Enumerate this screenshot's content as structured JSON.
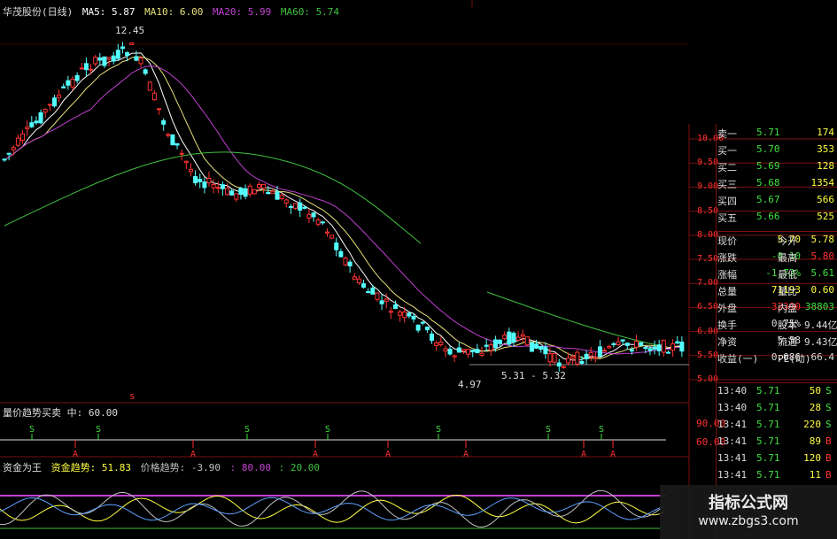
{
  "header": {
    "title": "华茂股份(日线)",
    "ma5": "MA5: 5.87",
    "ma10": "MA10: 6.00",
    "ma20": "MA20: 5.99",
    "ma60": "MA60: 5.74"
  },
  "annotations": {
    "high": "12.45",
    "low": "4.97",
    "range": "5.31 - 5.32",
    "marker": "s"
  },
  "price_axis": [
    "10.00",
    "9.50",
    "9.00",
    "8.50",
    "8.00",
    "7.50",
    "7.00",
    "6.50",
    "6.00",
    "5.50",
    "5.00"
  ],
  "vol_indicator": {
    "label": "量价趋势买卖 中: 60.00",
    "axis": [
      "90.00",
      "60.00"
    ]
  },
  "money_indicator": {
    "title": "资金为王",
    "fund": "资金趋势: 51.83",
    "price": "价格趋势: -3.90",
    "v80": ": 80.00",
    "v20": ": 20.00"
  },
  "order_book": [
    {
      "label": "卖一",
      "price": "5.71",
      "vol": "174"
    },
    {
      "label": "买一",
      "price": "5.70",
      "vol": "353"
    },
    {
      "label": "买二",
      "price": "5.69",
      "vol": "128"
    },
    {
      "label": "买三",
      "price": "5.68",
      "vol": "1354"
    },
    {
      "label": "买四",
      "price": "5.67",
      "vol": "566"
    },
    {
      "label": "买五",
      "price": "5.66",
      "vol": "525"
    }
  ],
  "quote": [
    {
      "l1": "现价",
      "v1": "5.70",
      "l2": "今开",
      "v2": "5.78"
    },
    {
      "l1": "涨跌",
      "v1": "-0.10",
      "l2": "最高",
      "v2": "5.80"
    },
    {
      "l1": "涨幅",
      "v1": "-1.72%",
      "l2": "最低",
      "v2": "5.61"
    },
    {
      "l1": "总量",
      "v1": "71193",
      "l2": "量比",
      "v2": "0.60"
    },
    {
      "l1": "外盘",
      "v1": "32390",
      "l2": "内盘",
      "v2": "38803"
    },
    {
      "l1": "换手",
      "v1": "0.75%",
      "l2": "股本",
      "v2": "9.44亿"
    },
    {
      "l1": "净资",
      "v1": "5.58",
      "l2": "流通",
      "v2": "9.43亿"
    },
    {
      "l1": "收益(一)",
      "v1": "0.086",
      "l2": "PE(动)",
      "v2": "66.4"
    }
  ],
  "ticks": [
    {
      "time": "13:40",
      "price": "5.71",
      "vol": "50",
      "side": "S"
    },
    {
      "time": "13:40",
      "price": "5.71",
      "vol": "28",
      "side": "S"
    },
    {
      "time": "13:41",
      "price": "5.71",
      "vol": "220",
      "side": "S"
    },
    {
      "time": "13:41",
      "price": "5.71",
      "vol": "89",
      "side": "B"
    },
    {
      "time": "13:41",
      "price": "5.71",
      "vol": "120",
      "side": "B"
    },
    {
      "time": "13:41",
      "price": "5.71",
      "vol": "11",
      "side": "B"
    }
  ],
  "watermark": {
    "name": "指标公式网",
    "url": "www.zbgs3.com"
  },
  "colors": {
    "up": "#ff3333",
    "down": "#54ffff",
    "ma5": "#ffffff",
    "ma10": "#e8e07a",
    "ma20": "#c040d0",
    "ma60": "#40c040",
    "grid": "#7a1010",
    "signal_s": "#40e040",
    "signal_b": "#ff3030",
    "label": "#c0c0c0",
    "yellow": "#ffff40"
  }
}
